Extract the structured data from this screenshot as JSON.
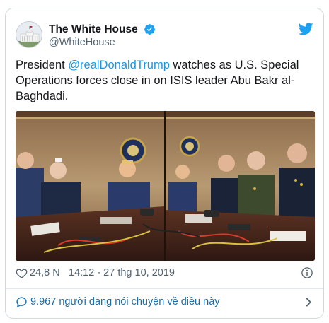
{
  "tweet": {
    "display_name": "The White House",
    "handle": "@WhiteHouse",
    "text_prefix": "President ",
    "mention": "@realDonaldTrump",
    "text_suffix": " watches as U.S. Special Operations forces close in on ISIS leader Abu Bakr al-Baghdadi.",
    "likes": "24,8 N",
    "timestamp": "14:12 - 27 thg 10, 2019",
    "conversation": "9.967 người đang nói chuyện về điều này"
  },
  "colors": {
    "accent": "#1da1f2",
    "mention": "#1b95e0",
    "secondary_text": "#536471",
    "border": "#cfd9de"
  },
  "icons": {
    "verified": "verified-badge-icon",
    "platform": "twitter-bird-icon",
    "like": "heart-icon",
    "info": "info-icon",
    "conversation": "speech-bubble-icon",
    "next": "chevron-right-icon"
  }
}
